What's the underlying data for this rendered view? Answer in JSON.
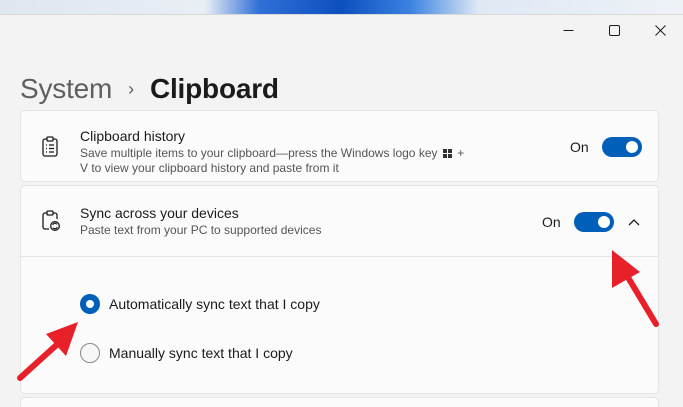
{
  "window": {
    "controls": [
      "minimize",
      "maximize",
      "close"
    ]
  },
  "breadcrumb": {
    "parent": "System",
    "separator": "›",
    "current": "Clipboard"
  },
  "clipboard_history": {
    "title": "Clipboard history",
    "description_part1": "Save multiple items to your clipboard—press the Windows logo key",
    "description_part2": "+",
    "description_part3": "V to view your clipboard history and paste from it",
    "toggle_label": "On",
    "toggle_on": true,
    "icon": "clipboard-list-icon"
  },
  "sync": {
    "title": "Sync across your devices",
    "description": "Paste text from your PC to supported devices",
    "toggle_label": "On",
    "toggle_on": true,
    "expanded": true,
    "icon": "clipboard-sync-icon",
    "options": [
      {
        "label": "Automatically sync text that I copy",
        "selected": true
      },
      {
        "label": "Manually sync text that I copy",
        "selected": false
      }
    ]
  },
  "colors": {
    "accent": "#005fb8",
    "annotation_arrow": "#e8202a"
  }
}
